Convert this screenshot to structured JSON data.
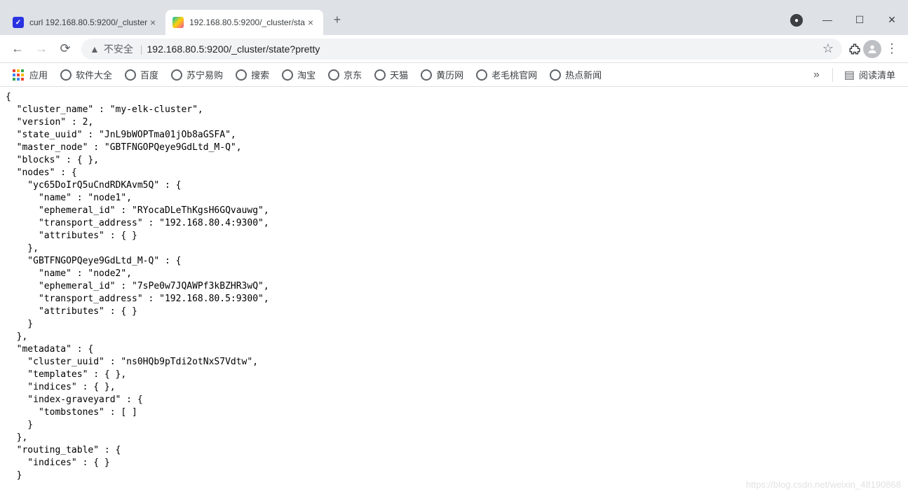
{
  "tabs": [
    {
      "title": "curl 192.168.80.5:9200/_cluster"
    },
    {
      "title": "192.168.80.5:9200/_cluster/sta"
    }
  ],
  "address": {
    "insecure_label": "不安全",
    "url": "192.168.80.5:9200/_cluster/state?pretty"
  },
  "bookmarks": {
    "apps": "应用",
    "items": [
      "软件大全",
      "百度",
      "苏宁易购",
      "搜索",
      "淘宝",
      "京东",
      "天猫",
      "黄历网",
      "老毛桃官网",
      "热点新闻"
    ],
    "more": "»",
    "reading_list": "阅读清单"
  },
  "json_body": "{\n  \"cluster_name\" : \"my-elk-cluster\",\n  \"version\" : 2,\n  \"state_uuid\" : \"JnL9bWOPTma01jOb8aGSFA\",\n  \"master_node\" : \"GBTFNGOPQeye9GdLtd_M-Q\",\n  \"blocks\" : { },\n  \"nodes\" : {\n    \"yc65DoIrQ5uCndRDKAvm5Q\" : {\n      \"name\" : \"node1\",\n      \"ephemeral_id\" : \"RYocaDLeThKgsH6GQvauwg\",\n      \"transport_address\" : \"192.168.80.4:9300\",\n      \"attributes\" : { }\n    },\n    \"GBTFNGOPQeye9GdLtd_M-Q\" : {\n      \"name\" : \"node2\",\n      \"ephemeral_id\" : \"7sPe0w7JQAWPf3kBZHR3wQ\",\n      \"transport_address\" : \"192.168.80.5:9300\",\n      \"attributes\" : { }\n    }\n  },\n  \"metadata\" : {\n    \"cluster_uuid\" : \"ns0HQb9pTdi2otNxS7Vdtw\",\n    \"templates\" : { },\n    \"indices\" : { },\n    \"index-graveyard\" : {\n      \"tombstones\" : [ ]\n    }\n  },\n  \"routing_table\" : {\n    \"indices\" : { }\n  }",
  "watermark": "https://blog.csdn.net/weixin_48190868"
}
